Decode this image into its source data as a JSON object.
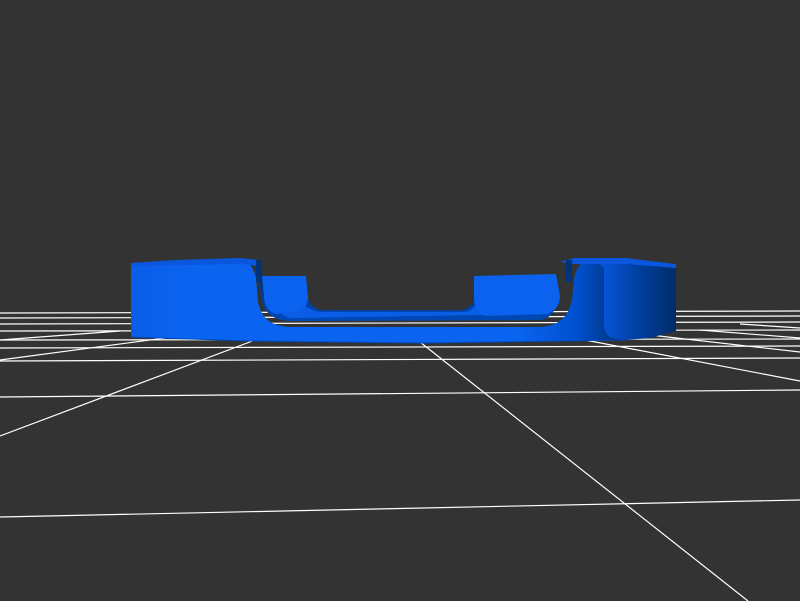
{
  "viewer": {
    "background_color": "#333333",
    "grid_color": "#ffffff",
    "model_color": "#0a64f0",
    "model_shadow_color": "#003a9a",
    "model_dark_color": "#00306e",
    "model_highlight_color": "#1f78ff"
  }
}
